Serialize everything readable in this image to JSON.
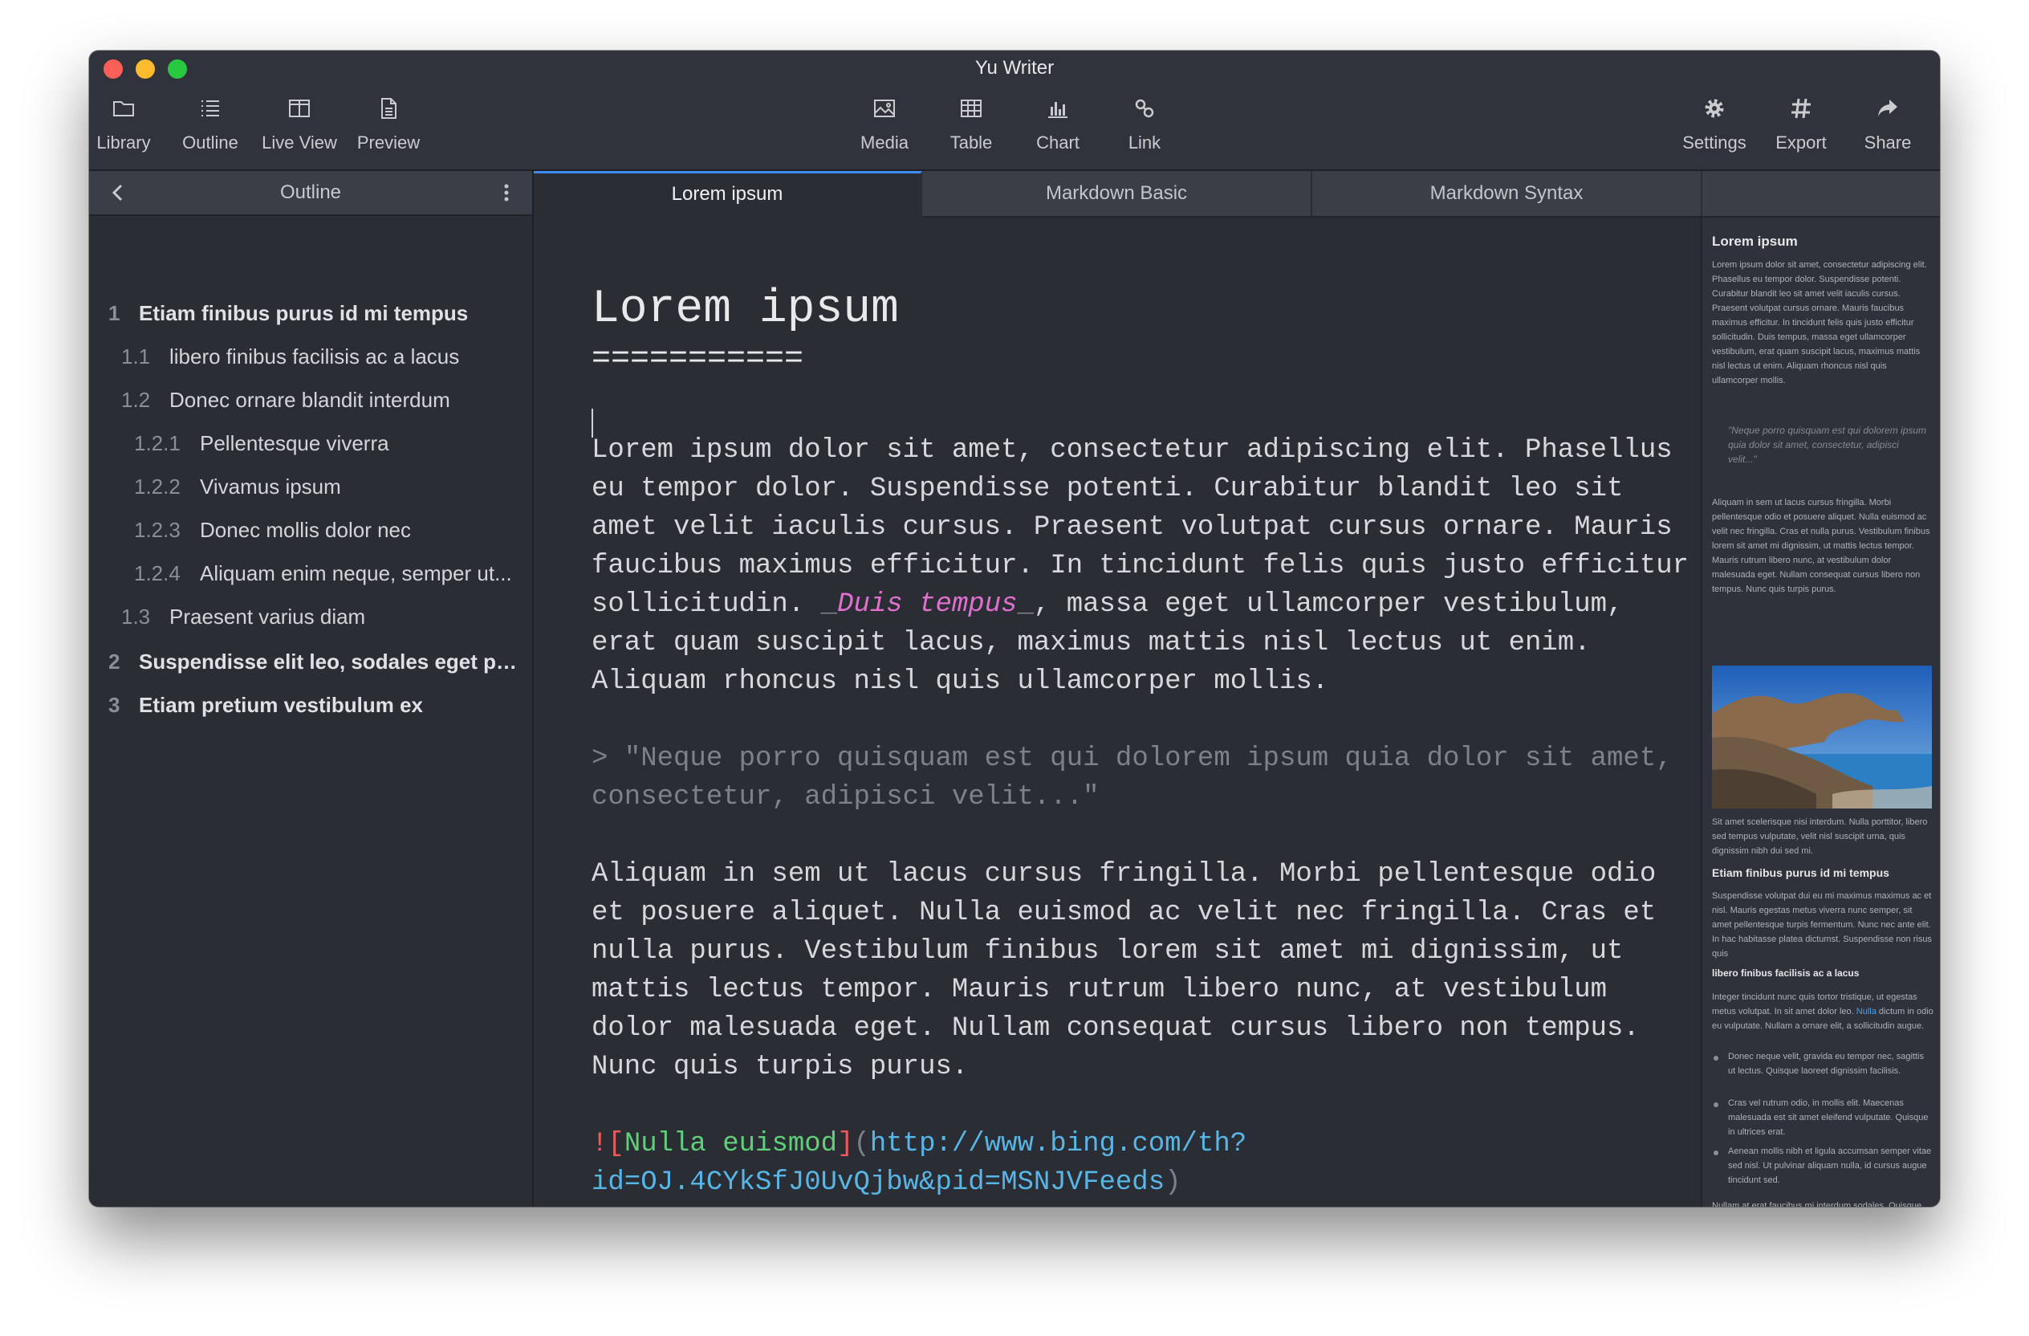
{
  "window": {
    "title": "Yu Writer"
  },
  "toolbar": {
    "library": "Library",
    "outline": "Outline",
    "live_view": "Live View",
    "preview": "Preview",
    "media": "Media",
    "table": "Table",
    "chart": "Chart",
    "link": "Link",
    "settings": "Settings",
    "export": "Export",
    "share": "Share"
  },
  "outline": {
    "header": "Outline",
    "items": [
      {
        "num": "1",
        "text": "Etiam finibus purus id mi tempus"
      },
      {
        "num": "1.1",
        "text": "libero finibus facilisis ac a lacus"
      },
      {
        "num": "1.2",
        "text": "Donec ornare blandit interdum"
      },
      {
        "num": "1.2.1",
        "text": "Pellentesque viverra"
      },
      {
        "num": "1.2.2",
        "text": "Vivamus ipsum"
      },
      {
        "num": "1.2.3",
        "text": "Donec mollis dolor nec"
      },
      {
        "num": "1.2.4",
        "text": "Aliquam enim neque, semper ut..."
      },
      {
        "num": "1.3",
        "text": "Praesent varius diam"
      },
      {
        "num": "2",
        "text": "Suspendisse elit leo, sodales eget pla..."
      },
      {
        "num": "3",
        "text": "Etiam pretium vestibulum ex"
      }
    ]
  },
  "tabs": [
    "Lorem ipsum",
    "Markdown Basic",
    "Markdown Syntax"
  ],
  "editor": {
    "heading": "Lorem ipsum",
    "heading_underline": "===========",
    "para1_lines": [
      "Lorem ipsum dolor sit amet, consectetur adipiscing elit. Phasellus",
      "eu tempor dolor. Suspendisse potenti. Curabitur blandit leo sit",
      "amet velit iaculis cursus. Praesent volutpat cursus ornare. Mauris",
      "faucibus maximus efficitur. In tincidunt felis quis justo efficitur"
    ],
    "para1_line5_pre": "sollicitudin. ",
    "para1_em_open": "_",
    "para1_em": "Duis tempus",
    "para1_em_close": "_",
    "para1_line5_post": ", massa eget ullamcorper vestibulum,",
    "para1_line6": "erat quam suscipit lacus, maximus mattis nisl lectus ut enim.",
    "para1_line7": "Aliquam rhoncus nisl quis ullamcorper mollis.",
    "quote_mark": "> ",
    "quote_line1": "\"Neque porro quisquam est qui dolorem ipsum quia dolor sit amet,",
    "quote_line2": "consectetur, adipisci velit...\"",
    "para2_lines": [
      "Aliquam in sem ut lacus cursus fringilla. Morbi pellentesque odio",
      "et posuere aliquet. Nulla euismod ac velit nec fringilla. Cras et",
      "nulla purus. Vestibulum finibus lorem sit amet mi dignissim, ut",
      "mattis lectus tempor. Mauris rutrum libero nunc, at vestibulum",
      "dolor malesuada eget. Nullam consequat cursus libero non tempus.",
      "Nunc quis turpis purus."
    ],
    "img_bang": "!",
    "img_open_bracket": "[",
    "img_alt": "Nulla euismod",
    "img_close_bracket": "]",
    "img_open_paren": "(",
    "img_url_line1": "http://www.bing.com/th?",
    "img_url_line2": "id=OJ.4CYkSfJ0UvQjbw&pid=MSNJVFeeds",
    "img_close_paren": ")"
  },
  "preview": {
    "h1": "Lorem ipsum",
    "p1": "Lorem ipsum dolor sit amet, consectetur adipiscing elit. Phasellus eu tempor dolor. Suspendisse potenti. Curabitur blandit leo sit amet velit iaculis cursus. Praesent volutpat cursus ornare. Mauris faucibus maximus efficitur. In tincidunt felis quis justo efficitur sollicitudin. Duis tempus, massa eget ullamcorper vestibulum, erat quam suscipit lacus, maximus mattis nisl lectus ut enim. Aliquam rhoncus nisl quis ullamcorper mollis.",
    "quote": "\"Neque porro quisquam est qui dolorem ipsum quia dolor sit amet, consectetur, adipisci velit...\"",
    "p2": "Aliquam in sem ut lacus cursus fringilla. Morbi pellentesque odio et posuere aliquet. Nulla euismod ac velit nec fringilla. Cras et nulla purus. Vestibulum finibus lorem sit amet mi dignissim, ut mattis lectus tempor. Mauris rutrum libero nunc, at vestibulum dolor malesuada eget. Nullam consequat cursus libero non tempus. Nunc quis turpis purus.",
    "p3": "Sit amet scelerisque nisi interdum. Nulla porttitor, libero sed tempus vulputate, velit nisl suscipit urna, quis dignissim nibh dui sed mi.",
    "h2": "Etiam finibus purus id mi tempus",
    "p4": "Suspendisse volutpat dui eu mi maximus maximus ac et nisl. Mauris egestas metus viverra nunc semper, sit amet pellentesque turpis fermentum. Nunc nec ante elit. In hac habitasse platea dictumst. Suspendisse non risus quis",
    "h3": "libero finibus facilisis ac a lacus",
    "p5_pre": "Integer tincidunt nunc quis tortor tristique, ut egestas metus volutpat. In sit amet dolor leo. ",
    "p5_link": "Nulla",
    "p5_post": " dictum in odio eu vulputate. Nullam a ornare elit, a sollicitudin augue.",
    "li1": "Donec neque velit, gravida eu tempor nec, sagittis ut lectus. Quisque laoreet dignissim facilisis.",
    "li2": "Cras vel rutrum odio, in mollis elit. Maecenas malesuada est sit amet eleifend vulputate. Quisque in ultrices erat.",
    "li3": "Aenean mollis nibh et ligula accumsan semper vitae sed nisl. Ut pulvinar aliquam nulla, id cursus augue tincidunt sed.",
    "p6": "Nullam at erat faucibus mi interdum sodales. Quisque venenatis sagittis justo a volutpat. Nam libero enim, auctor iaculis velit tincidunt, blandit blandit enim. Donec iaculis, diam sed mollis"
  },
  "colors": {
    "window_bg": "#2a2d34",
    "toolbar_bg": "#30333b",
    "tab_active_accent": "#3d8cf0",
    "emphasis": "#e06fce",
    "url": "#58b6e6",
    "image_alt": "#5fcf7a"
  }
}
